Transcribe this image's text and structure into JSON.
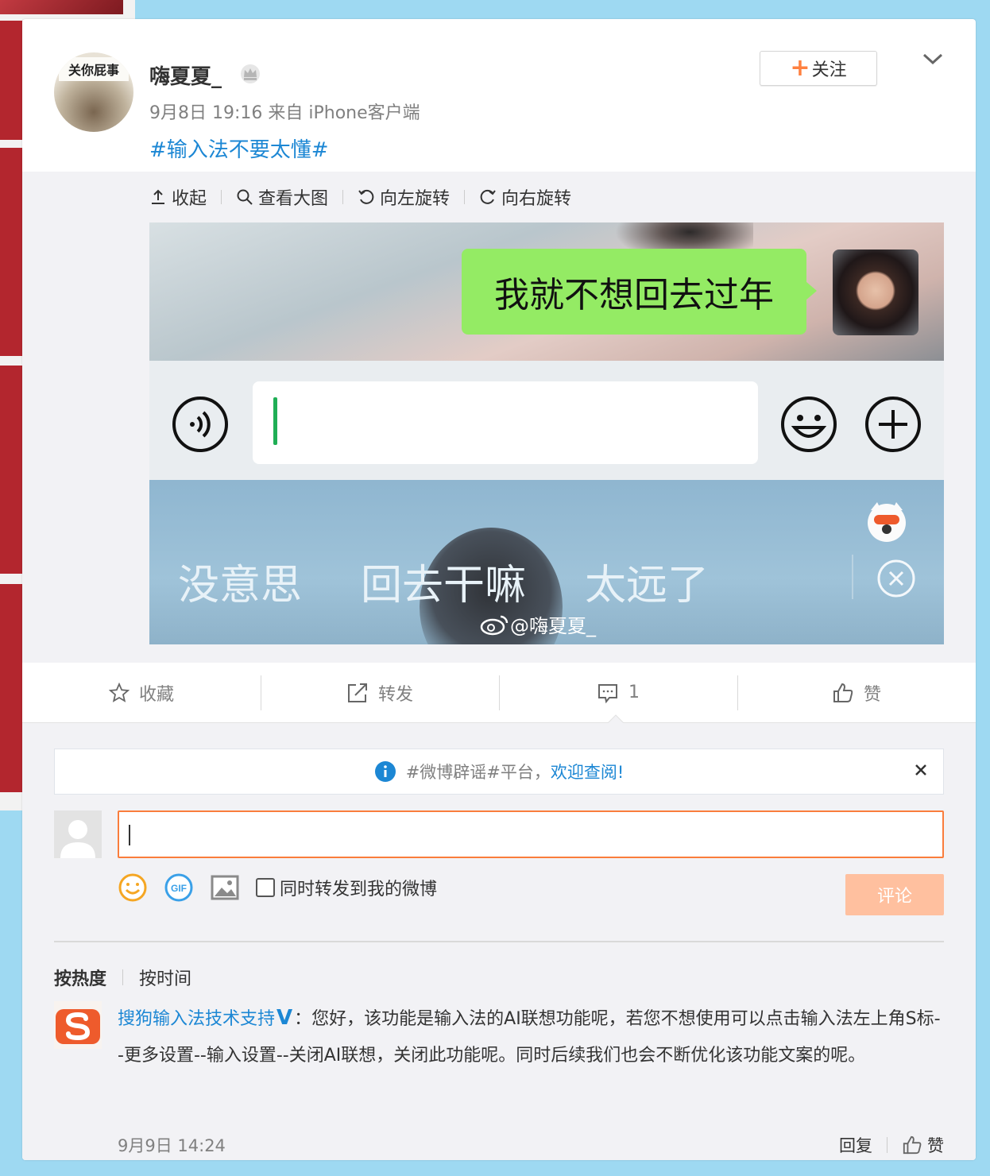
{
  "post": {
    "avatar_sign": "关你屁事",
    "username": "嗨夏夏_",
    "time": "9月8日 19:16 来自 iPhone客户端",
    "text": "#输入法不要太懂#",
    "follow_label": "关注"
  },
  "media_toolbar": {
    "collapse": "收起",
    "view_large": "查看大图",
    "rotate_left": "向左旋转",
    "rotate_right": "向右旋转"
  },
  "image_content": {
    "bubble_text": "我就不想回去过年",
    "suggestions": [
      "没意思",
      "回去干嘛",
      "太远了"
    ],
    "watermark": "@嗨夏夏_"
  },
  "actions": {
    "favorite": "收藏",
    "repost": "转发",
    "comment_count": "1",
    "like": "赞"
  },
  "notice": {
    "prefix": "#微博辟谣#平台，",
    "link": "欢迎查阅!"
  },
  "composer": {
    "also_repost": "同时转发到我的微博",
    "submit": "评论"
  },
  "sort": {
    "hot": "按热度",
    "time": "按时间"
  },
  "comment": {
    "author": "搜狗输入法技术支持",
    "badge": "V",
    "text": "：您好，该功能是输入法的AI联想功能呢，若您不想使用可以点击输入法左上角S标--更多设置--输入设置--关闭AI联想，关闭此功能呢。同时后续我们也会不断优化该功能文案的呢。",
    "time": "9月9日 14:24",
    "reply": "回复",
    "like": "赞"
  },
  "colors": {
    "link_blue": "#1c87d4",
    "accent_orange": "#fa7d3c",
    "bubble_green": "#94eb64"
  }
}
